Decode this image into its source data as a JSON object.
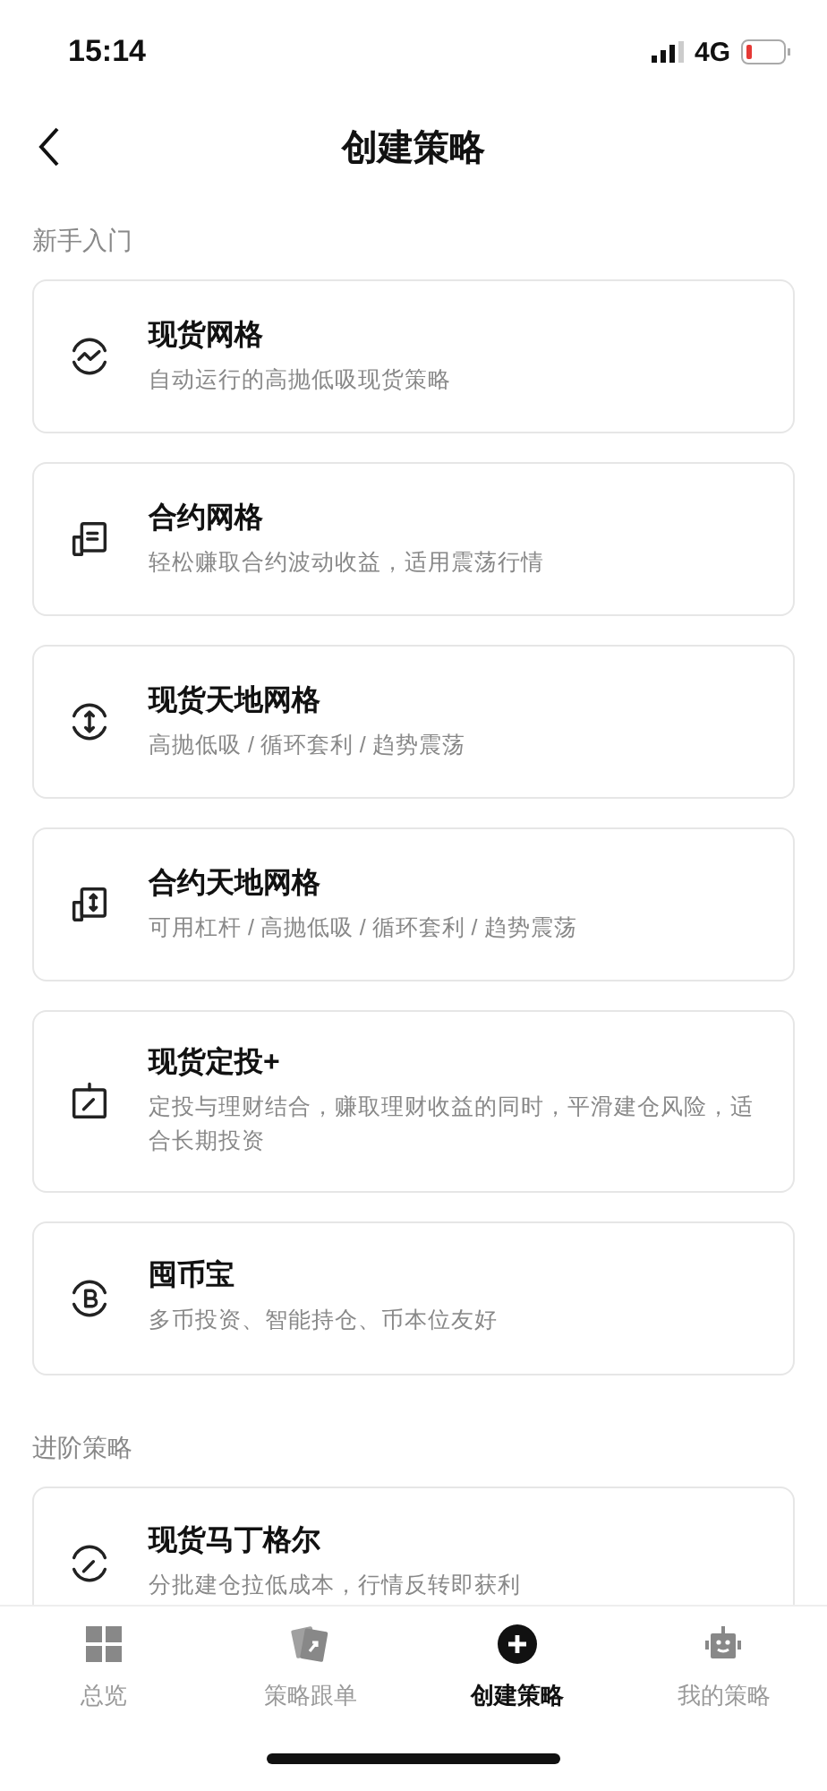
{
  "status_bar": {
    "time": "15:14",
    "network": "4G"
  },
  "header": {
    "title": "创建策略"
  },
  "sections": [
    {
      "title": "新手入门",
      "items": [
        {
          "title": "现货网格",
          "description": "自动运行的高抛低吸现货策略"
        },
        {
          "title": "合约网格",
          "description": "轻松赚取合约波动收益，适用震荡行情"
        },
        {
          "title": "现货天地网格",
          "description": "高抛低吸 / 循环套利 / 趋势震荡"
        },
        {
          "title": "合约天地网格",
          "description": "可用杠杆 / 高抛低吸 / 循环套利 / 趋势震荡"
        },
        {
          "title": "现货定投+",
          "description": "定投与理财结合，赚取理财收益的同时，平滑建仓风险，适合长期投资"
        },
        {
          "title": "囤币宝",
          "description": "多币投资、智能持仓、币本位友好"
        }
      ]
    },
    {
      "title": "进阶策略",
      "items": [
        {
          "title": "现货马丁格尔",
          "description": "分批建仓拉低成本，行情反转即获利"
        }
      ]
    }
  ],
  "tab_bar": [
    {
      "label": "总览",
      "selected": false
    },
    {
      "label": "策略跟单",
      "selected": false
    },
    {
      "label": "创建策略",
      "selected": true
    },
    {
      "label": "我的策略",
      "selected": false
    }
  ]
}
